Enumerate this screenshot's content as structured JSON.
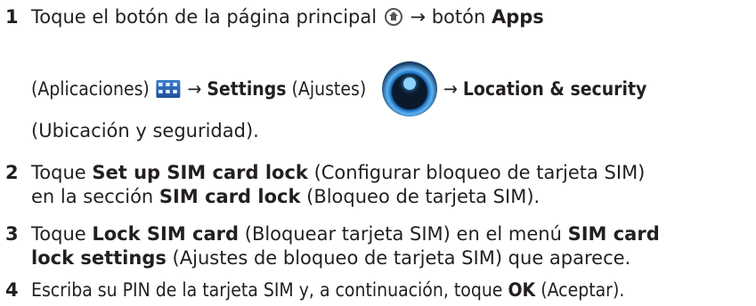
{
  "steps": [
    {
      "number": "1",
      "line1": {
        "text_a": "Toque el botón de la página principal",
        "text_b": "→ botón",
        "bold_a": "Apps"
      },
      "line2": {
        "text_a": "(Aplicaciones)",
        "text_b": "→",
        "bold_a": "Settings",
        "text_c": "(Ajustes)",
        "text_d": "→",
        "bold_b": "Location & security"
      },
      "line3": "(Ubicación y seguridad)."
    },
    {
      "number": "2",
      "line1": {
        "text_a": "Toque",
        "bold_a": "Set up SIM card lock",
        "text_b": "(Configurar bloqueo de tarjeta SIM)"
      },
      "line2": {
        "text_a": "en la sección",
        "bold_a": "SIM card lock",
        "text_b": "(Bloqueo de tarjeta SIM)."
      }
    },
    {
      "number": "3",
      "line1": {
        "text_a": "Toque",
        "bold_a": "Lock SIM card",
        "text_b": "(Bloquear tarjeta SIM) en el menú",
        "bold_b": "SIM card"
      },
      "line2": {
        "bold_a": "lock settings",
        "text_a": "(Ajustes de bloqueo de tarjeta SIM) que aparece."
      }
    },
    {
      "number": "4",
      "line1": {
        "text_a": "Escriba su PIN de la tarjeta SIM y, a continuación, toque",
        "bold_a": "OK",
        "text_b": "(Aceptar)."
      }
    }
  ],
  "icons": [
    "home-icon",
    "apps-icon",
    "settings-icon"
  ]
}
